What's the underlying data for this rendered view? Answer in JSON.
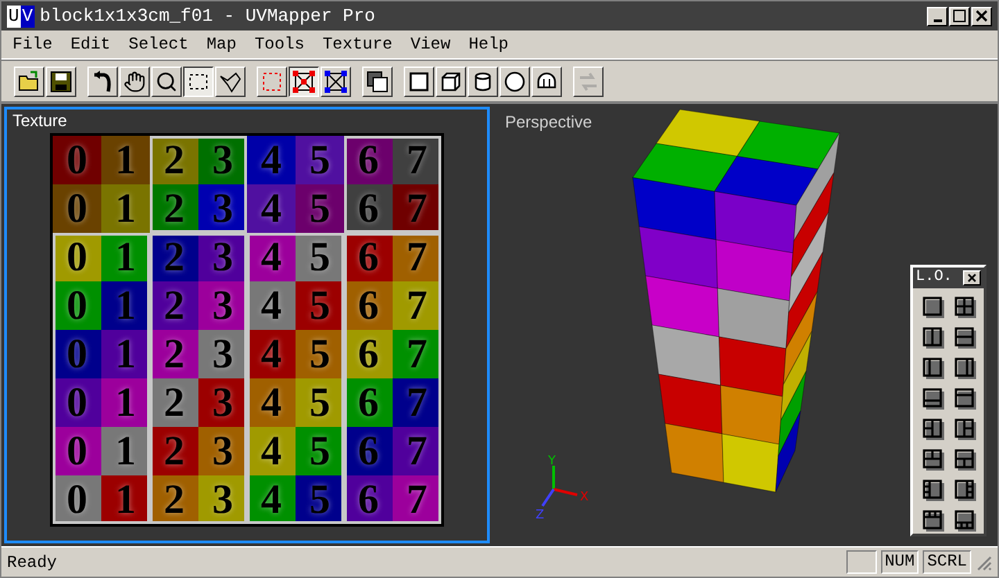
{
  "window": {
    "app_icon": "UV",
    "title": "block1x1x3cm_f01 - UVMapper Pro"
  },
  "menu": [
    "File",
    "Edit",
    "Select",
    "Map",
    "Tools",
    "Texture",
    "View",
    "Help"
  ],
  "toolbar": [
    [
      {
        "kind": "open",
        "selected": false,
        "disabled": false
      },
      {
        "kind": "save",
        "selected": false,
        "disabled": false
      }
    ],
    [
      {
        "kind": "undo",
        "selected": false,
        "disabled": false
      },
      {
        "kind": "pan",
        "selected": false,
        "disabled": false
      },
      {
        "kind": "zoom",
        "selected": false,
        "disabled": false
      },
      {
        "kind": "marquee",
        "selected": true,
        "disabled": false
      },
      {
        "kind": "lasso",
        "selected": false,
        "disabled": false
      }
    ],
    [
      {
        "kind": "faces",
        "selected": false,
        "disabled": false
      },
      {
        "kind": "vertices",
        "selected": true,
        "disabled": false
      },
      {
        "kind": "edges",
        "selected": false,
        "disabled": false
      }
    ],
    [
      {
        "kind": "layers",
        "selected": false,
        "disabled": false
      }
    ],
    [
      {
        "kind": "plane",
        "selected": false,
        "disabled": false
      },
      {
        "kind": "box",
        "selected": false,
        "disabled": false
      },
      {
        "kind": "cylinder",
        "selected": false,
        "disabled": false
      },
      {
        "kind": "sphere",
        "selected": false,
        "disabled": false
      },
      {
        "kind": "dome",
        "selected": false,
        "disabled": false
      }
    ],
    [
      {
        "kind": "swap",
        "selected": false,
        "disabled": true
      }
    ]
  ],
  "texture_view": {
    "title": "Texture",
    "selected": true,
    "cells": [
      [
        {
          "label": "0",
          "color": "#700000"
        },
        {
          "label": "1",
          "color": "#6a4200"
        },
        {
          "label": "2",
          "color": "#7a7400"
        },
        {
          "label": "3",
          "color": "#007000"
        },
        {
          "label": "4",
          "color": "#0000a8"
        },
        {
          "label": "5",
          "color": "#5010a0"
        },
        {
          "label": "6",
          "color": "#6c006c"
        },
        {
          "label": "7",
          "color": "#404040"
        }
      ],
      [
        {
          "label": "0",
          "color": "#6a4200"
        },
        {
          "label": "1",
          "color": "#7a7400"
        },
        {
          "label": "2",
          "color": "#007800"
        },
        {
          "label": "3",
          "color": "#0000b0"
        },
        {
          "label": "4",
          "color": "#5010a0"
        },
        {
          "label": "5",
          "color": "#6c006c"
        },
        {
          "label": "6",
          "color": "#404040"
        },
        {
          "label": "7",
          "color": "#700000"
        }
      ],
      [
        {
          "label": "0",
          "color": "#a09a00"
        },
        {
          "label": "1",
          "color": "#009000"
        },
        {
          "label": "2",
          "color": "#00008c"
        },
        {
          "label": "3",
          "color": "#50009c"
        },
        {
          "label": "4",
          "color": "#9c009c"
        },
        {
          "label": "5",
          "color": "#787878"
        },
        {
          "label": "6",
          "color": "#9c0000"
        },
        {
          "label": "7",
          "color": "#a06000"
        }
      ],
      [
        {
          "label": "0",
          "color": "#009000"
        },
        {
          "label": "1",
          "color": "#00008c"
        },
        {
          "label": "2",
          "color": "#50009c"
        },
        {
          "label": "3",
          "color": "#9c009c"
        },
        {
          "label": "4",
          "color": "#787878"
        },
        {
          "label": "5",
          "color": "#9c0000"
        },
        {
          "label": "6",
          "color": "#a06000"
        },
        {
          "label": "7",
          "color": "#a09a00"
        }
      ],
      [
        {
          "label": "0",
          "color": "#00008c"
        },
        {
          "label": "1",
          "color": "#50009c"
        },
        {
          "label": "2",
          "color": "#9c009c"
        },
        {
          "label": "3",
          "color": "#787878"
        },
        {
          "label": "4",
          "color": "#9c0000"
        },
        {
          "label": "5",
          "color": "#a06000"
        },
        {
          "label": "6",
          "color": "#a09a00"
        },
        {
          "label": "7",
          "color": "#009000"
        }
      ],
      [
        {
          "label": "0",
          "color": "#50009c"
        },
        {
          "label": "1",
          "color": "#9c009c"
        },
        {
          "label": "2",
          "color": "#787878"
        },
        {
          "label": "3",
          "color": "#9c0000"
        },
        {
          "label": "4",
          "color": "#a06000"
        },
        {
          "label": "5",
          "color": "#a09a00"
        },
        {
          "label": "6",
          "color": "#009000"
        },
        {
          "label": "7",
          "color": "#00008c"
        }
      ],
      [
        {
          "label": "0",
          "color": "#9c009c"
        },
        {
          "label": "1",
          "color": "#787878"
        },
        {
          "label": "2",
          "color": "#9c0000"
        },
        {
          "label": "3",
          "color": "#a06000"
        },
        {
          "label": "4",
          "color": "#a09a00"
        },
        {
          "label": "5",
          "color": "#009000"
        },
        {
          "label": "6",
          "color": "#00008c"
        },
        {
          "label": "7",
          "color": "#50009c"
        }
      ],
      [
        {
          "label": "0",
          "color": "#787878"
        },
        {
          "label": "1",
          "color": "#9c0000"
        },
        {
          "label": "2",
          "color": "#a06000"
        },
        {
          "label": "3",
          "color": "#a09a00"
        },
        {
          "label": "4",
          "color": "#009000"
        },
        {
          "label": "5",
          "color": "#00008c"
        },
        {
          "label": "6",
          "color": "#50009c"
        },
        {
          "label": "7",
          "color": "#9c009c"
        }
      ]
    ]
  },
  "perspective_view": {
    "title": "Perspective",
    "axes": [
      "Y",
      "X",
      "Z"
    ]
  },
  "layout_palette": {
    "title": "L.O.",
    "layouts": [
      {
        "kind": "single"
      },
      {
        "kind": "quad"
      },
      {
        "kind": "vsplit"
      },
      {
        "kind": "hsplit"
      },
      {
        "kind": "left"
      },
      {
        "kind": "right"
      },
      {
        "kind": "bottom"
      },
      {
        "kind": "top"
      },
      {
        "kind": "leftpair"
      },
      {
        "kind": "rightpair"
      },
      {
        "kind": "toppair"
      },
      {
        "kind": "bottompair"
      },
      {
        "kind": "leftthree"
      },
      {
        "kind": "rightthree"
      },
      {
        "kind": "topthree"
      },
      {
        "kind": "bottomthree"
      }
    ]
  },
  "status_bar": {
    "text": "Ready",
    "indicators": [
      "NUM",
      "SCRL"
    ]
  }
}
